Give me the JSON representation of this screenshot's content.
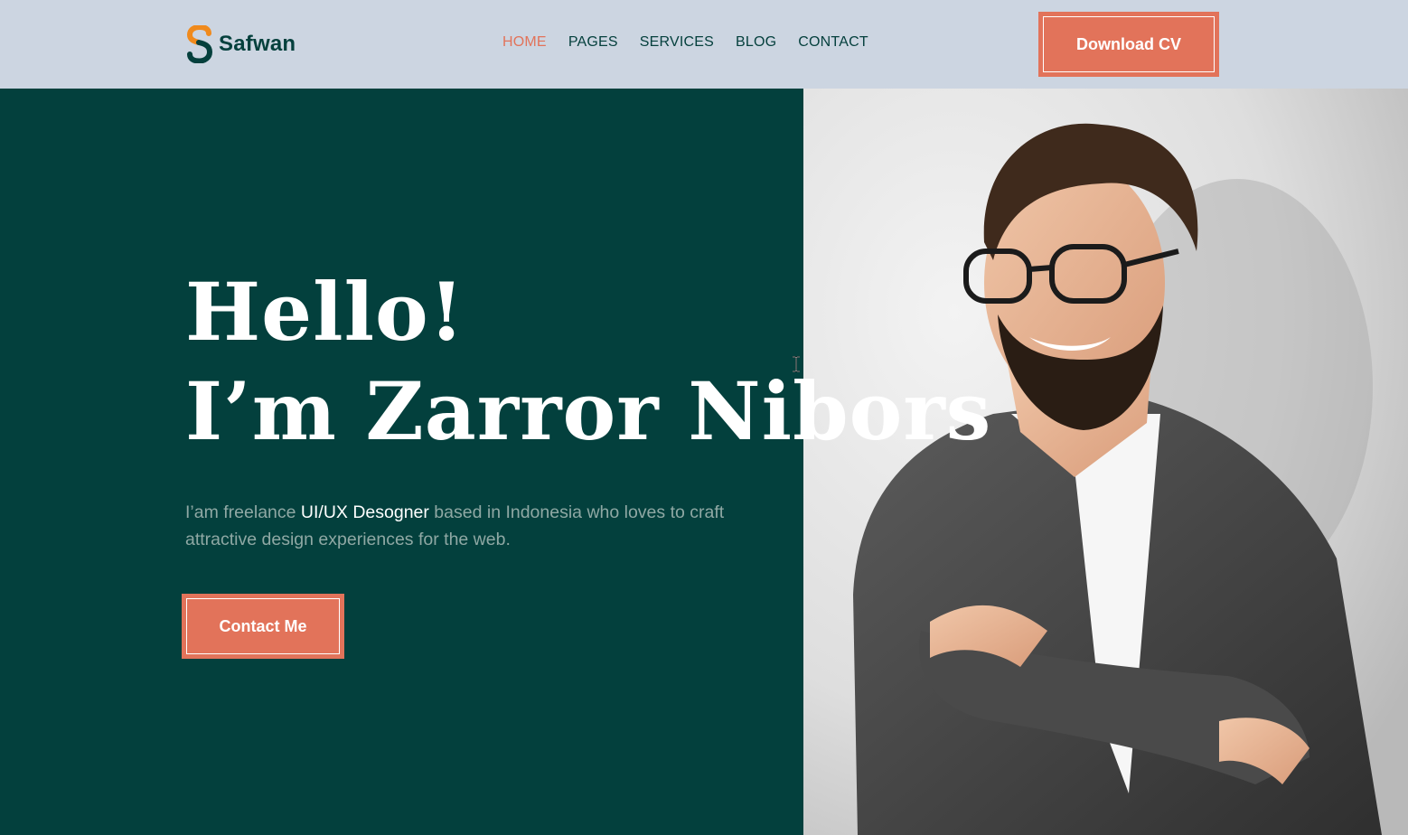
{
  "brand": {
    "name": "Safwan",
    "logo_icon": "s-logo-icon",
    "logo_colors": [
      "#f08a1c",
      "#05403d"
    ]
  },
  "nav": {
    "items": [
      {
        "label": "HOME",
        "active": true
      },
      {
        "label": "PAGES",
        "active": false
      },
      {
        "label": "SERVICES",
        "active": false
      },
      {
        "label": "BLOG",
        "active": false
      },
      {
        "label": "CONTACT",
        "active": false
      }
    ]
  },
  "header": {
    "download_label": "Download CV"
  },
  "hero": {
    "line1": "Hello!",
    "line2": "I’m Zarror Nibors",
    "intro_before": "I’am freelance ",
    "intro_highlight": "UI/UX Desogner",
    "intro_after": " based in Indonesia who loves to craft attractive design experiences for the web.",
    "contact_label": "Contact Me",
    "portrait": "portrait-photo"
  },
  "colors": {
    "brand_dark": "#03403d",
    "accent": "#e2735a",
    "header_bg": "#ccd5e1",
    "muted_text": "#8fa8a4"
  }
}
